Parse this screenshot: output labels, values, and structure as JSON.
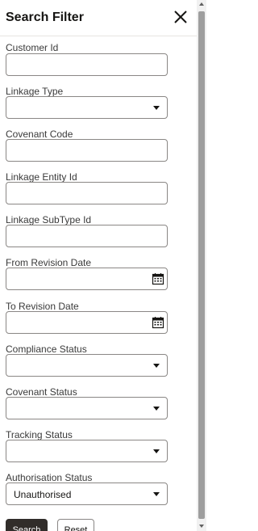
{
  "header": {
    "title": "Search Filter",
    "close_icon": "close-icon"
  },
  "fields": {
    "customer_id": {
      "label": "Customer Id",
      "value": ""
    },
    "linkage_type": {
      "label": "Linkage Type",
      "value": ""
    },
    "covenant_code": {
      "label": "Covenant Code",
      "value": ""
    },
    "linkage_entity_id": {
      "label": "Linkage Entity Id",
      "value": ""
    },
    "linkage_subtype_id": {
      "label": "Linkage SubType Id",
      "value": ""
    },
    "from_revision_date": {
      "label": "From Revision Date",
      "value": ""
    },
    "to_revision_date": {
      "label": "To Revision Date",
      "value": ""
    },
    "compliance_status": {
      "label": "Compliance Status",
      "value": ""
    },
    "covenant_status": {
      "label": "Covenant Status",
      "value": ""
    },
    "tracking_status": {
      "label": "Tracking Status",
      "value": ""
    },
    "authorisation_status": {
      "label": "Authorisation Status",
      "value": "Unauthorised"
    }
  },
  "buttons": {
    "search": "Search",
    "reset": "Reset"
  },
  "colors": {
    "primary_button": "#312d2a",
    "border": "#8a8785"
  }
}
